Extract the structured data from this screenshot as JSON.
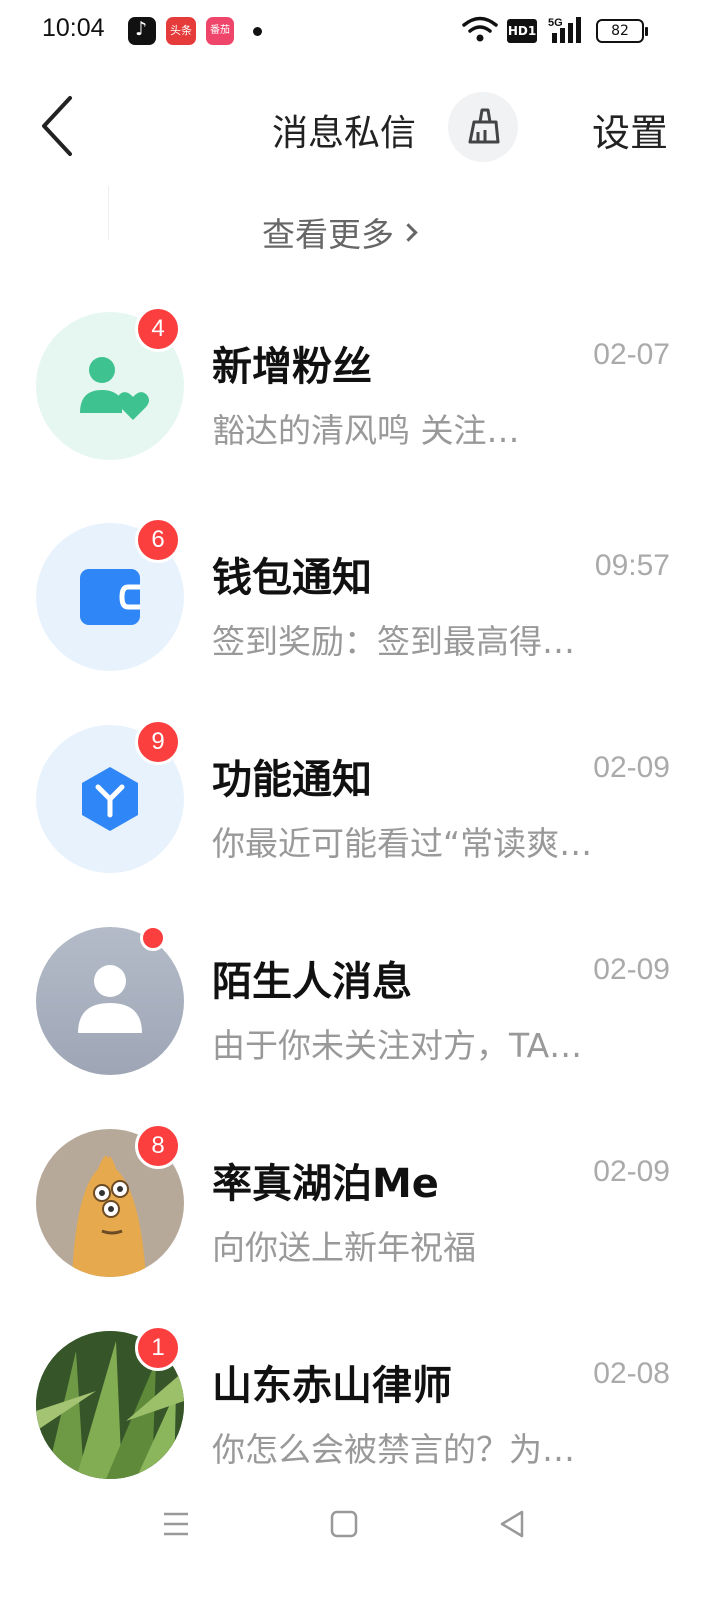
{
  "status_bar": {
    "time": "10:04",
    "apps": [
      "tiktok-icon",
      "toutiao-icon",
      "fanqie-icon"
    ],
    "toutiao_label": "头条",
    "fanqie_label": "番茄",
    "hd_label": "HD1",
    "network_label": "5G",
    "battery": "82"
  },
  "header": {
    "title": "消息私信",
    "settings_label": "设置"
  },
  "see_more_label": "查看更多",
  "messages": [
    {
      "title": "新增粉丝",
      "time": "02-07",
      "preview": "豁达的清风鸣 关注…",
      "badge": "4",
      "avatar_icon": "new-follower-icon",
      "avatar_bg": "#e6f7f1"
    },
    {
      "title": "钱包通知",
      "time": "09:57",
      "preview": "签到奖励：签到最高得…",
      "badge": "6",
      "avatar_icon": "wallet-icon",
      "avatar_bg": "#e8f2fd"
    },
    {
      "title": "功能通知",
      "time": "02-09",
      "preview": "你最近可能看过“常读爽…",
      "badge": "9",
      "avatar_icon": "cube-icon",
      "avatar_bg": "#e8f2fd"
    },
    {
      "title": "陌生人消息",
      "time": "02-09",
      "preview": "由于你未关注对方，TA…",
      "badge": "",
      "avatar_icon": "person-icon",
      "avatar_bg": "#a9b1c0"
    },
    {
      "title": "率真湖泊Me",
      "time": "02-09",
      "preview": "向你送上新年祝福",
      "badge": "8",
      "avatar_icon": "cartoon-avatar",
      "avatar_bg": "#b7a999"
    },
    {
      "title": "山东赤山律师",
      "time": "02-08",
      "preview": "你怎么会被禁言的？为…",
      "badge": "1",
      "avatar_icon": "plant-photo-avatar",
      "avatar_bg": "#4e7a35"
    }
  ],
  "colors": {
    "badge_red": "#fb3e3e",
    "follower_green": "#3ec28f",
    "wallet_blue": "#2f86f6"
  }
}
